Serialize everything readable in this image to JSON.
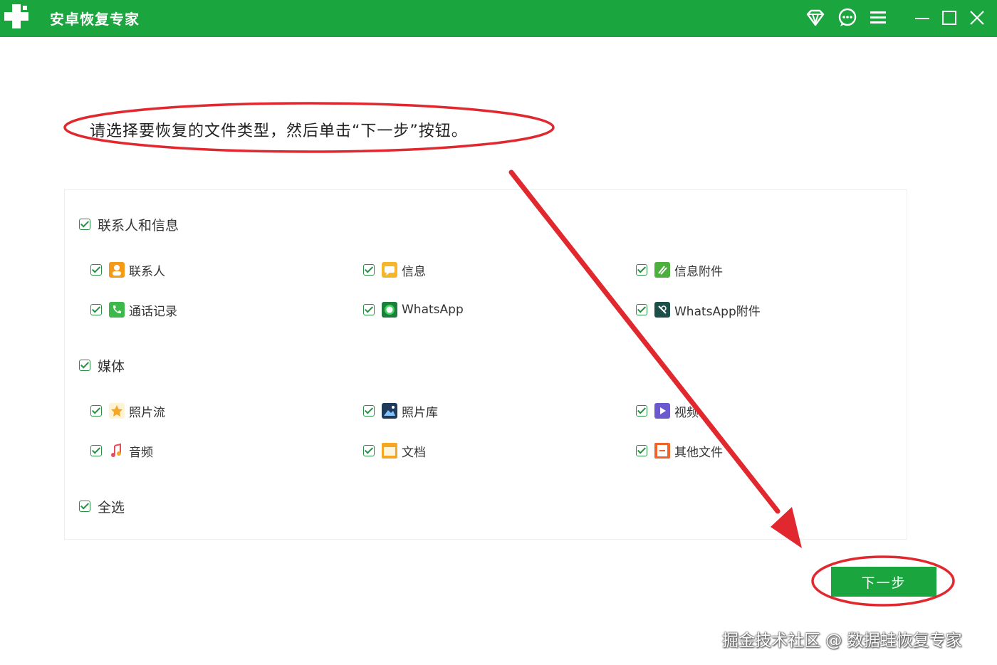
{
  "app": {
    "title": "安卓恢复专家"
  },
  "instruction": "请选择要恢复的文件类型，然后单击“下一步”按钮。",
  "groups": [
    {
      "label": "联系人和信息",
      "items": [
        {
          "label": "联系人",
          "icon": "contacts-icon"
        },
        {
          "label": "信息",
          "icon": "message-icon"
        },
        {
          "label": "信息附件",
          "icon": "message-attachment-icon"
        },
        {
          "label": "通话记录",
          "icon": "phone-icon"
        },
        {
          "label": "WhatsApp",
          "icon": "whatsapp-icon"
        },
        {
          "label": "WhatsApp附件",
          "icon": "whatsapp-attachment-icon"
        }
      ]
    },
    {
      "label": "媒体",
      "items": [
        {
          "label": "照片流",
          "icon": "photo-stream-icon"
        },
        {
          "label": "照片库",
          "icon": "photo-library-icon"
        },
        {
          "label": "视频",
          "icon": "video-icon"
        },
        {
          "label": "音频",
          "icon": "audio-icon"
        },
        {
          "label": "文档",
          "icon": "document-icon"
        },
        {
          "label": "其他文件",
          "icon": "other-files-icon"
        }
      ]
    }
  ],
  "select_all": "全选",
  "next_button": "下一步",
  "watermark": "掘金技术社区 @ 数据蛙恢复专家",
  "colors": {
    "brand_green": "#1ba53e",
    "checkbox_green": "#2a8f45",
    "annotation_red": "#e0282e"
  }
}
